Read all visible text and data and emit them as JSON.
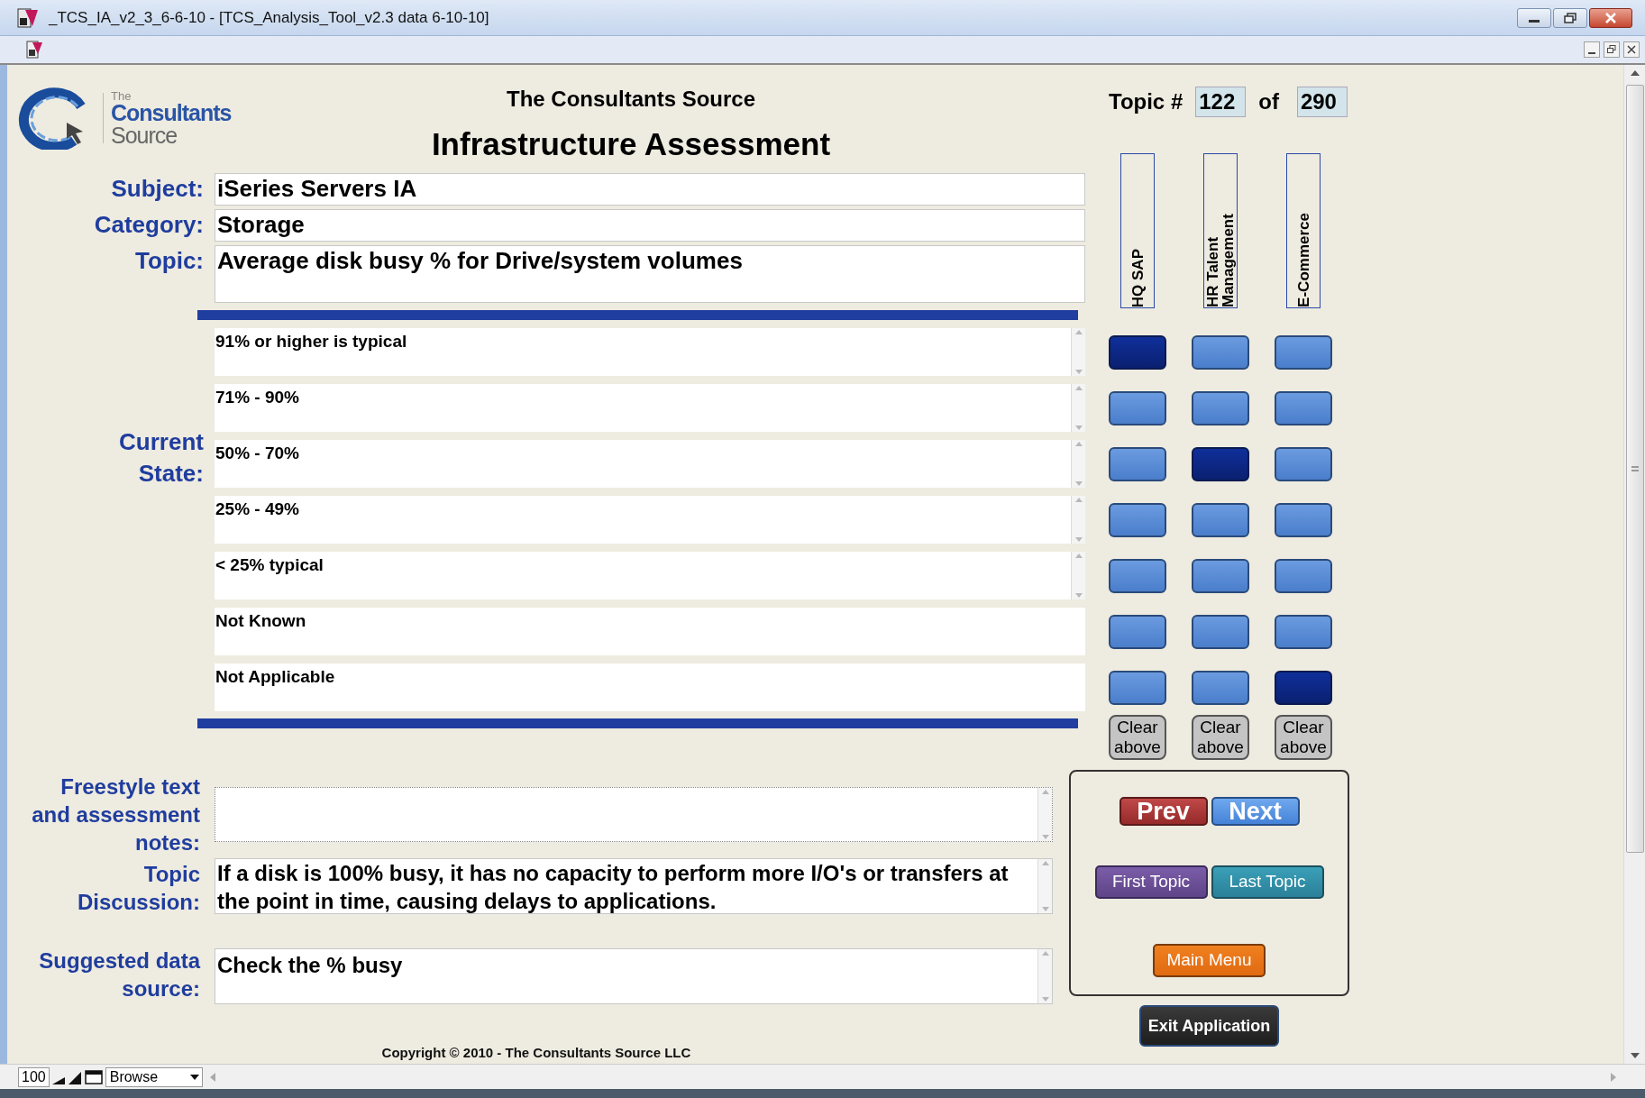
{
  "window": {
    "title": "_TCS_IA_v2_3_6-6-10 - [TCS_Analysis_Tool_v2.3 data 6-10-10]"
  },
  "header": {
    "logo_small": "The",
    "logo_main": "Consultants",
    "logo_sub": "Source",
    "company": "The Consultants Source",
    "heading": "Infrastructure Assessment"
  },
  "topic_counter": {
    "label": "Topic #",
    "current": "122",
    "of_label": "of",
    "total": "290"
  },
  "fields": [
    {
      "label": "Subject:",
      "value": "iSeries Servers IA"
    },
    {
      "label": "Category:",
      "value": "Storage"
    },
    {
      "label": "Topic:",
      "value": "Average disk busy % for Drive/system volumes"
    }
  ],
  "columns": [
    {
      "name": "HQ SAP"
    },
    {
      "name": "HR Talent Management"
    },
    {
      "name": "E-Commerce"
    }
  ],
  "current_state": {
    "label": "Current State:",
    "options": [
      {
        "text": "91% or higher is typical",
        "scrollbar": true,
        "choices": [
          {
            "selected": true
          },
          {
            "selected": false
          },
          {
            "selected": false
          }
        ]
      },
      {
        "text": "71% - 90%",
        "scrollbar": true,
        "choices": [
          {
            "selected": false
          },
          {
            "selected": false
          },
          {
            "selected": false
          }
        ]
      },
      {
        "text": "50% - 70%",
        "scrollbar": true,
        "choices": [
          {
            "selected": false
          },
          {
            "selected": true
          },
          {
            "selected": false
          }
        ]
      },
      {
        "text": "25% - 49%",
        "scrollbar": true,
        "choices": [
          {
            "selected": false
          },
          {
            "selected": false
          },
          {
            "selected": false
          }
        ]
      },
      {
        "text": "< 25% typical",
        "scrollbar": true,
        "choices": [
          {
            "selected": false
          },
          {
            "selected": false
          },
          {
            "selected": false
          }
        ]
      },
      {
        "text": "Not Known",
        "scrollbar": false,
        "choices": [
          {
            "selected": false
          },
          {
            "selected": false
          },
          {
            "selected": false
          }
        ]
      },
      {
        "text": "Not Applicable",
        "scrollbar": false,
        "choices": [
          {
            "selected": false
          },
          {
            "selected": false
          },
          {
            "selected": true
          }
        ]
      }
    ]
  },
  "clear_buttons": [
    "Clear above",
    "Clear above",
    "Clear above"
  ],
  "freestyle": {
    "label": "Freestyle text and assessment notes:"
  },
  "discussion": {
    "label": "Topic Discussion:",
    "value": "If a disk is 100% busy, it has no capacity to perform more I/O's or transfers at the point in time, causing delays to applications."
  },
  "data_source": {
    "label": "Suggested data source:",
    "value": "Check the % busy"
  },
  "nav_buttons": [
    {
      "label": "Prev",
      "kind": "prev"
    },
    {
      "label": "Next",
      "kind": "next"
    },
    {
      "label": "First Topic",
      "kind": "first"
    },
    {
      "label": "Last Topic",
      "kind": "last"
    },
    {
      "label": "Main Menu",
      "kind": "menu"
    }
  ],
  "exit_button": "Exit Application",
  "copyright": "Copyright © 2010 - The Consultants Source LLC",
  "status_bar": {
    "zoom": "100",
    "mode": "Browse"
  }
}
